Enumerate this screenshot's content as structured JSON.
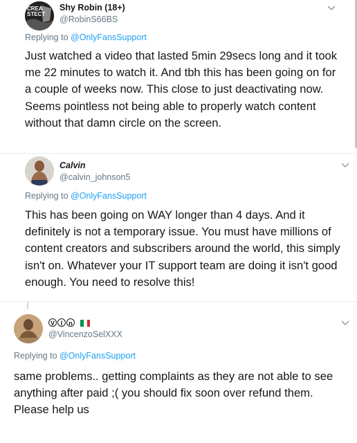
{
  "tweets": [
    {
      "name": "Shy Robin (18+)",
      "handle": "@RobinS66BS",
      "replying_prefix": "Replying to ",
      "replying_to": "@OnlyFansSupport",
      "avatar_text": "CREA\nSTECT",
      "text": "Just watched a video that lasted 5min 29secs long and it took me 22 minutes to watch it. And tbh this has been going on for a couple of weeks now. This close to just deactivating now. Seems pointless not being able to properly watch content without that damn circle on the screen."
    },
    {
      "name": "Calvin",
      "handle": "@calvin_johnson5",
      "replying_prefix": "Replying to ",
      "replying_to": "@OnlyFansSupport",
      "text": "This has been going on WAY longer than 4 days. And it definitely is not a temporary issue. You must have millions of content creators and subscribers around the world, this simply isn't on. Whatever your IT support team are doing it isn't good enough. You need to resolve this!"
    },
    {
      "name_letters": [
        "V",
        "I",
        "n"
      ],
      "flag_colors": [
        "#009246",
        "#ffffff",
        "#ce2b37"
      ],
      "handle": "@VincenzoSelXXX",
      "replying_prefix": "Replying to ",
      "replying_to": "@OnlyFansSupport",
      "text": "same problems.. getting complaints as they are not able to see anything after paid ;( you should fix soon over refund them. Please help us"
    }
  ],
  "colors": {
    "link": "#1da1f2",
    "muted": "#657786",
    "text": "#14171a"
  }
}
